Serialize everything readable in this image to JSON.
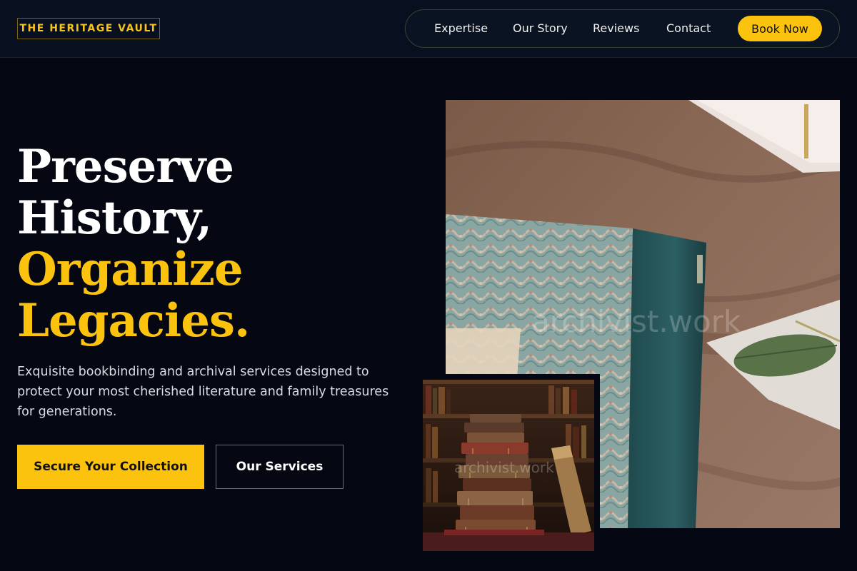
{
  "header": {
    "logo": "THE HERITAGE VAULT",
    "nav": [
      {
        "label": "Expertise"
      },
      {
        "label": "Our Story"
      },
      {
        "label": "Reviews"
      },
      {
        "label": "Contact"
      }
    ],
    "cta_label": "Book Now"
  },
  "hero": {
    "headline_line1": "Preserve",
    "headline_line2": "History,",
    "headline_line3": "Organize",
    "headline_line4": "Legacies.",
    "description": "Exquisite bookbinding and archival services designed to protect your most cherished literature and family treasures for generations.",
    "primary_button": "Secure Your Collection",
    "secondary_button": "Our Services"
  },
  "images": {
    "main_watermark": "archivist.work",
    "small_watermark": "archivist.work"
  },
  "colors": {
    "background": "#050812",
    "header": "#081020",
    "accent": "#fcc30e",
    "text": "#ffffff"
  }
}
